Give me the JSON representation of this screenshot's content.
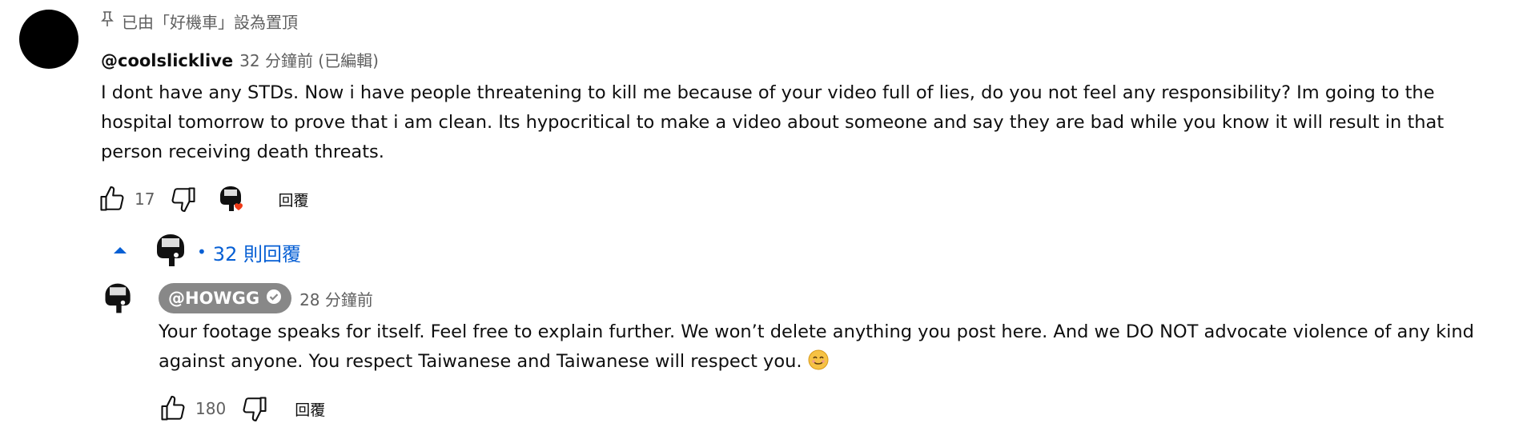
{
  "comment": {
    "pinned_label": "已由「好機車」設為置頂",
    "author": "@coolslicklive",
    "time": "32 分鐘前 (已編輯)",
    "text": "I dont have any STDs. Now i have people threatening to kill me because of your video full of lies, do you not feel any responsibility? Im going to the hospital tomorrow to prove that i am clean. Its hypocritical to make a video about someone and say they are bad while you know it will result in that person receiving death threats.",
    "like_count": "17",
    "reply_label": "回覆",
    "icons": {
      "pin": "pin-icon",
      "like": "thumbs-up-icon",
      "dislike": "thumbs-down-icon",
      "creator_heart": "creator-heart-icon"
    }
  },
  "replies_toggle": {
    "label": "32 則回覆",
    "icon": "chevron-up-icon"
  },
  "reply": {
    "author": "@HOWGG",
    "time": "28 分鐘前",
    "text": "Your footage speaks for itself. Feel free to explain further. We won’t delete anything you post here. And we DO NOT advocate violence of any kind against anyone. You respect Taiwanese and Taiwanese will respect you.",
    "like_count": "180",
    "reply_label": "回覆",
    "icons": {
      "verified": "verified-check-icon",
      "emoji": "smiling-face-emoji"
    }
  },
  "colors": {
    "link_blue": "#065fd4",
    "meta_gray": "#606060",
    "owner_chip": "#888888",
    "heart_red": "#f03a17"
  }
}
